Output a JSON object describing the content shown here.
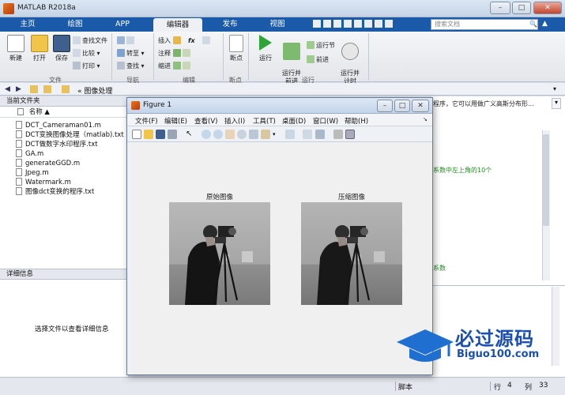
{
  "app": {
    "title": "MATLAB R2018a"
  },
  "window_controls": {
    "minimize": "–",
    "maximize": "□",
    "close": "✕"
  },
  "tabs": [
    {
      "label": "主页",
      "active": false
    },
    {
      "label": "绘图",
      "active": false
    },
    {
      "label": "APP",
      "active": false
    },
    {
      "label": "编辑器",
      "active": true
    },
    {
      "label": "发布",
      "active": false
    },
    {
      "label": "视图",
      "active": false
    }
  ],
  "search": {
    "placeholder": "搜索文档"
  },
  "toolstrip": {
    "file": {
      "section": "文件",
      "new": "新建",
      "open": "打开",
      "save": "保存",
      "find_files": "查找文件",
      "compare": "比较",
      "print": "打印"
    },
    "navigate": {
      "section": "导航",
      "goto": "转至",
      "find": "查找"
    },
    "edit": {
      "section": "编辑",
      "insert": "插入",
      "comment": "注释",
      "indent": "缩进",
      "fx": "fx"
    },
    "breakpoints": {
      "section": "断点",
      "breakpoints": "断点"
    },
    "run": {
      "section": "运行",
      "run": "运行",
      "run_advance": "运行并\n前进",
      "run_section": "运行节",
      "advance": "前进",
      "run_time": "运行并\n计时"
    }
  },
  "address": {
    "path": "« 图像处理"
  },
  "folder_panel": {
    "header": "当前文件夹",
    "column": "名称 ▲",
    "files": [
      "DCT_Cameraman01.m",
      "DCT变换图像处理（matlab).txt",
      "DCT做数字水印程序.txt",
      "GA.m",
      "generateGGD.m",
      "Jpeg.m",
      "Watermark.m",
      "图像dct变换的程序.txt"
    ]
  },
  "details_panel": {
    "header": "详细信息",
    "message": "选择文件以查看详细信息"
  },
  "editor": {
    "line1": "程序，它可以用做广义高斯分布形...",
    "line2": "系数中左上角的10个",
    "line3": "系数"
  },
  "statusbar": {
    "script": "脚本",
    "row_label": "行",
    "row": "4",
    "col_label": "列",
    "col": "33"
  },
  "figure": {
    "title": "Figure 1",
    "menus": [
      "文件(F)",
      "编辑(E)",
      "查看(V)",
      "插入(I)",
      "工具(T)",
      "桌面(D)",
      "窗口(W)",
      "帮助(H)"
    ],
    "axes": [
      {
        "title": "原始图像"
      },
      {
        "title": "压缩图像"
      }
    ]
  },
  "watermark": {
    "text": "必过源码",
    "url": "Biguo100.com"
  },
  "colors": {
    "tabbar": "#1a5aa8",
    "accent": "#1a5aa8",
    "comment_green": "#228b22"
  }
}
